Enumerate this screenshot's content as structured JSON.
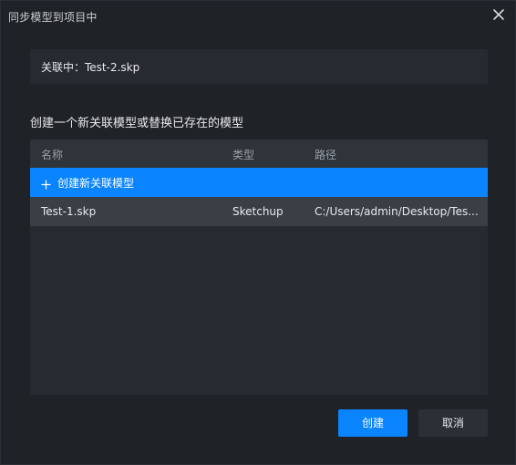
{
  "dialog": {
    "title": "同步模型到项目中",
    "close_icon": "close-icon"
  },
  "linked": {
    "text": "关联中：Test-2.skp"
  },
  "section": {
    "title": "创建一个新关联模型或替换已存在的模型"
  },
  "table": {
    "columns": [
      "名称",
      "类型",
      "路径"
    ],
    "create_row": {
      "icon": "plus-icon",
      "label": "创建新关联模型"
    },
    "rows": [
      {
        "name": "Test-1.skp",
        "type": "Sketchup",
        "path": "C:/Users/admin/Desktop/Tes..."
      }
    ]
  },
  "footer": {
    "create_label": "创建",
    "cancel_label": "取消"
  },
  "colors": {
    "accent": "#0a84ff",
    "background": "#1f2227",
    "panel": "#272b31",
    "selected_row": "#3a3e45"
  }
}
